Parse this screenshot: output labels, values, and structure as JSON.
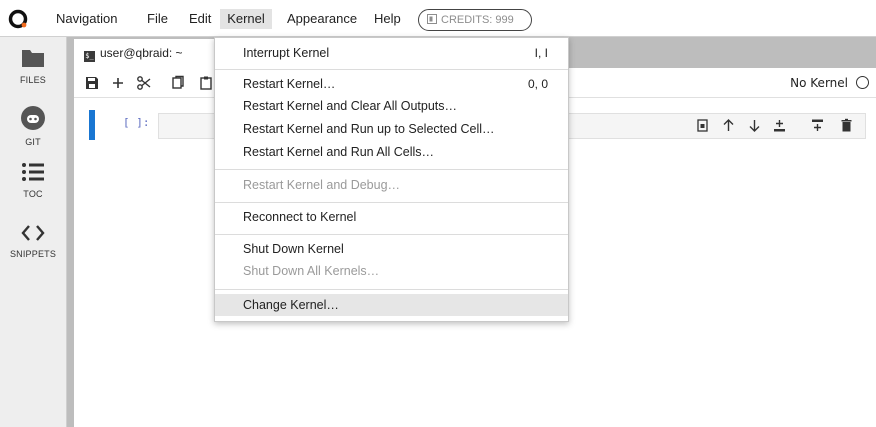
{
  "menubar": {
    "items": [
      "Navigation",
      "File",
      "Edit",
      "Kernel",
      "Appearance",
      "Help"
    ],
    "credits": "CREDITS: 999"
  },
  "sidebar": {
    "items": [
      {
        "label": "FILES",
        "icon": "folder-icon"
      },
      {
        "label": "GIT",
        "icon": "git-icon"
      },
      {
        "label": "TOC",
        "icon": "list-icon"
      },
      {
        "label": "SNIPPETS",
        "icon": "code-icon"
      }
    ]
  },
  "tab": {
    "label": "user@qbraid: ~"
  },
  "toolbar": {
    "kernel_name": "No Kernel"
  },
  "cell": {
    "prompt": "[ ]:"
  },
  "kernel_menu": {
    "items": [
      {
        "label": "Interrupt Kernel",
        "shortcut": "I, I",
        "disabled": false
      },
      {
        "label": "Restart Kernel…",
        "shortcut": "0, 0",
        "disabled": false
      },
      {
        "label": "Restart Kernel and Clear All Outputs…",
        "shortcut": "",
        "disabled": false
      },
      {
        "label": "Restart Kernel and Run up to Selected Cell…",
        "shortcut": "",
        "disabled": false
      },
      {
        "label": "Restart Kernel and Run All Cells…",
        "shortcut": "",
        "disabled": false
      },
      {
        "label": "Restart Kernel and Debug…",
        "shortcut": "",
        "disabled": true
      },
      {
        "label": "Reconnect to Kernel",
        "shortcut": "",
        "disabled": false
      },
      {
        "label": "Shut Down Kernel",
        "shortcut": "",
        "disabled": false
      },
      {
        "label": "Shut Down All Kernels…",
        "shortcut": "",
        "disabled": true
      },
      {
        "label": "Change Kernel…",
        "shortcut": "",
        "disabled": false
      }
    ]
  },
  "colors": {
    "accent": "#1976d2",
    "sidebar_bg": "#eeeeee",
    "tabbar_bg": "#bdbdbd",
    "menu_hover": "#e6e6e6"
  }
}
